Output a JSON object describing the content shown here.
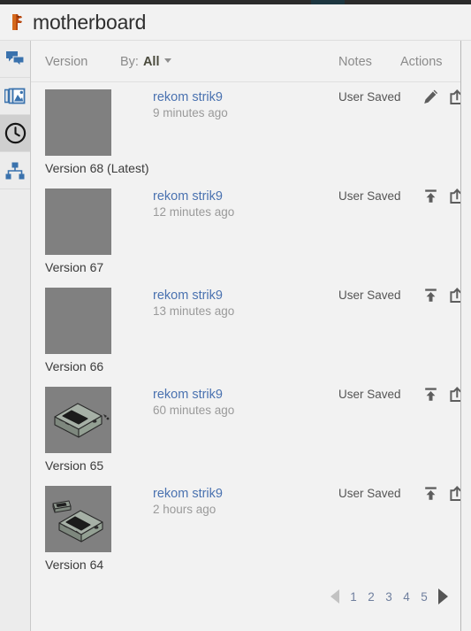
{
  "window": {
    "title": "motherboard",
    "logo_icon": "beaver-logo-icon"
  },
  "sidebar": {
    "items": [
      {
        "name": "comments",
        "icon": "chat-bubbles-icon",
        "active": false
      },
      {
        "name": "renders",
        "icon": "image-stack-icon",
        "active": false
      },
      {
        "name": "versions",
        "icon": "clock-icon",
        "active": true
      },
      {
        "name": "structure",
        "icon": "hierarchy-icon",
        "active": false
      }
    ]
  },
  "table": {
    "headers": {
      "version": "Version",
      "by_label": "By:",
      "by_value": "All",
      "by_caret_icon": "chevron-down-icon",
      "notes": "Notes",
      "actions": "Actions"
    },
    "rows": [
      {
        "caption": "Version 68 (Latest)",
        "user": "rekom strik9",
        "time": "9 minutes ago",
        "notes": "User Saved",
        "thumbnail": "blank-gray-thumbnail",
        "actions": [
          "pencil-icon",
          "share-icon"
        ]
      },
      {
        "caption": "Version 67",
        "user": "rekom strik9",
        "time": "12 minutes ago",
        "notes": "User Saved",
        "thumbnail": "blank-gray-thumbnail",
        "actions": [
          "restore-icon",
          "share-icon"
        ]
      },
      {
        "caption": "Version 66",
        "user": "rekom strik9",
        "time": "13 minutes ago",
        "notes": "User Saved",
        "thumbnail": "blank-gray-thumbnail",
        "actions": [
          "restore-icon",
          "share-icon"
        ]
      },
      {
        "caption": "Version 65",
        "user": "rekom strik9",
        "time": "60 minutes ago",
        "notes": "User Saved",
        "thumbnail": "cad-model-thumbnail",
        "actions": [
          "restore-icon",
          "share-icon"
        ]
      },
      {
        "caption": "Version 64",
        "user": "rekom strik9",
        "time": "2 hours ago",
        "notes": "User Saved",
        "thumbnail": "cad-model-with-part-thumbnail",
        "actions": [
          "restore-icon",
          "share-icon"
        ]
      }
    ]
  },
  "pagination": {
    "prev_icon": "triangle-left-icon",
    "next_icon": "triangle-right-icon",
    "pages": [
      "1",
      "2",
      "3",
      "4",
      "5"
    ],
    "prev_enabled": false,
    "next_enabled": true
  },
  "colors": {
    "link": "#4a72b0",
    "page_bg": "#f1f1f1",
    "panel_bg": "#f2f2f2",
    "rail_bg": "#ececec",
    "rail_active": "#cfcfcf",
    "icon_blue": "#3a72ad",
    "thumb_gray": "#808080",
    "logo_orange": "#b8480f"
  }
}
